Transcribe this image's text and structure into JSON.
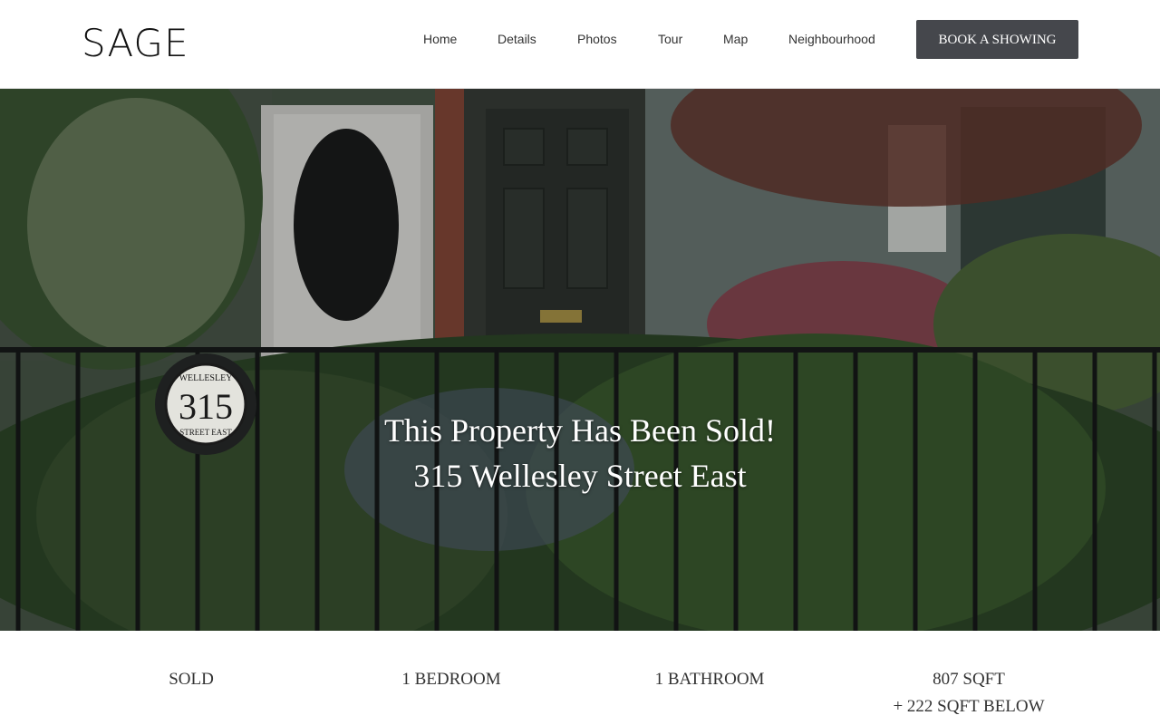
{
  "brand": {
    "logo": "SAGE"
  },
  "nav": {
    "items": [
      "Home",
      "Details",
      "Photos",
      "Tour",
      "Map",
      "Neighbourhood"
    ],
    "cta": "BOOK A SHOWING"
  },
  "hero": {
    "line1": "This Property Has Been Sold!",
    "line2": "315 Wellesley Street East",
    "plaque": {
      "number": "315",
      "top_text": "WELLESLEY",
      "bottom_text": "STREET EAST"
    }
  },
  "stats": [
    {
      "label": "SOLD",
      "extra": ""
    },
    {
      "label": "1 BEDROOM",
      "extra": ""
    },
    {
      "label": "1 BATHROOM",
      "extra": ""
    },
    {
      "label": "807 SQFT",
      "extra": "+ 222 SQFT BELOW"
    }
  ],
  "colors": {
    "cta_bg": "#45474c",
    "text": "#333333",
    "door": "#2f3530",
    "brick": "#8a4a3a"
  }
}
